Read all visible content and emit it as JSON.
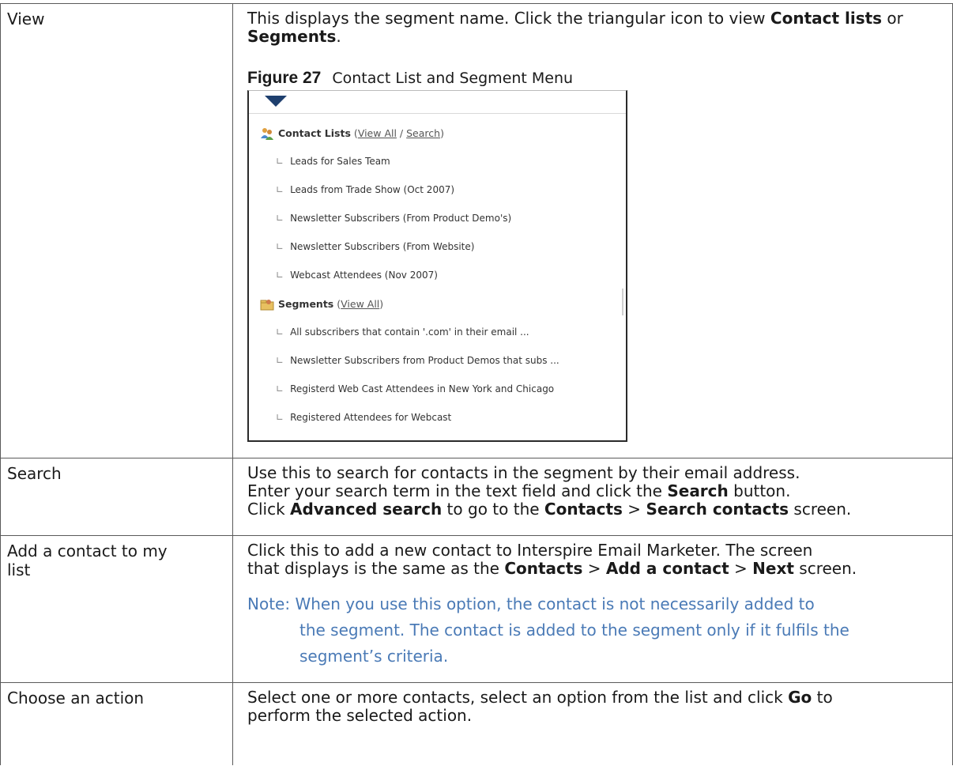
{
  "rows": [
    {
      "term": "View",
      "desc_parts": {
        "a": "This displays the segment name. Click the triangular icon to view ",
        "b1": "Contact lists",
        "c": " or ",
        "b2": "Segments",
        "d": "."
      },
      "figure": {
        "number": "Figure 27",
        "title": "Contact List and Segment Menu",
        "menu": {
          "contact_lists": {
            "label": "Contact Lists",
            "open": "(",
            "view_all": "View All",
            "slash": " / ",
            "search": "Search",
            "close": ")",
            "items": [
              "Leads for Sales Team",
              "Leads from Trade Show (Oct 2007)",
              "Newsletter Subscribers (From Product Demo's)",
              "Newsletter Subscribers (From Website)",
              "Webcast Attendees (Nov 2007)"
            ]
          },
          "segments": {
            "label": "Segments",
            "open": "(",
            "view_all": "View All",
            "close": ")",
            "items": [
              "All subscribers that contain '.com' in their email ...",
              "Newsletter Subscribers from Product Demos that subs ...",
              "Registerd Web Cast Attendees in New York and Chicago",
              "Registered Attendees for Webcast"
            ]
          },
          "branch_glyph": "∟"
        }
      }
    },
    {
      "term": "Search",
      "line1": "Use this to search for contacts in the segment by their email address.",
      "line2a": "Enter your search term in the text field and click the ",
      "line2b": "Search",
      "line2c": " button.",
      "line3a": "Click ",
      "line3b": "Advanced search",
      "line3c": " to go to the ",
      "line3d": "Contacts",
      "line3e": " > ",
      "line3f": "Search contacts",
      "line3g": " screen."
    },
    {
      "term": "Add a contact to my list",
      "line1": "Click this to add a new contact to Interspire Email Marketer. The screen",
      "line2a": "that displays is the same as the ",
      "line2b": "Contacts",
      "line2c": " > ",
      "line2d": "Add a contact",
      "line2e": " > ",
      "line2f": "Next",
      "line2g": " screen.",
      "note1": "Note: When you use this option, the contact is not necessarily added to",
      "note2": "the segment. The contact is added to the segment only if it fulfils the",
      "note3": "segment’s criteria."
    },
    {
      "term": "Choose an action",
      "line1a": "Select one or more contacts, select an option from the list and click ",
      "line1b": "Go",
      "line1c": " to",
      "line2": "perform the selected action."
    }
  ],
  "colors": {
    "note": "#4a7ab6",
    "triangle": "#1e3f6e"
  },
  "icons": [
    "contact-lists-icon",
    "segments-icon",
    "dropdown-triangle-icon"
  ]
}
